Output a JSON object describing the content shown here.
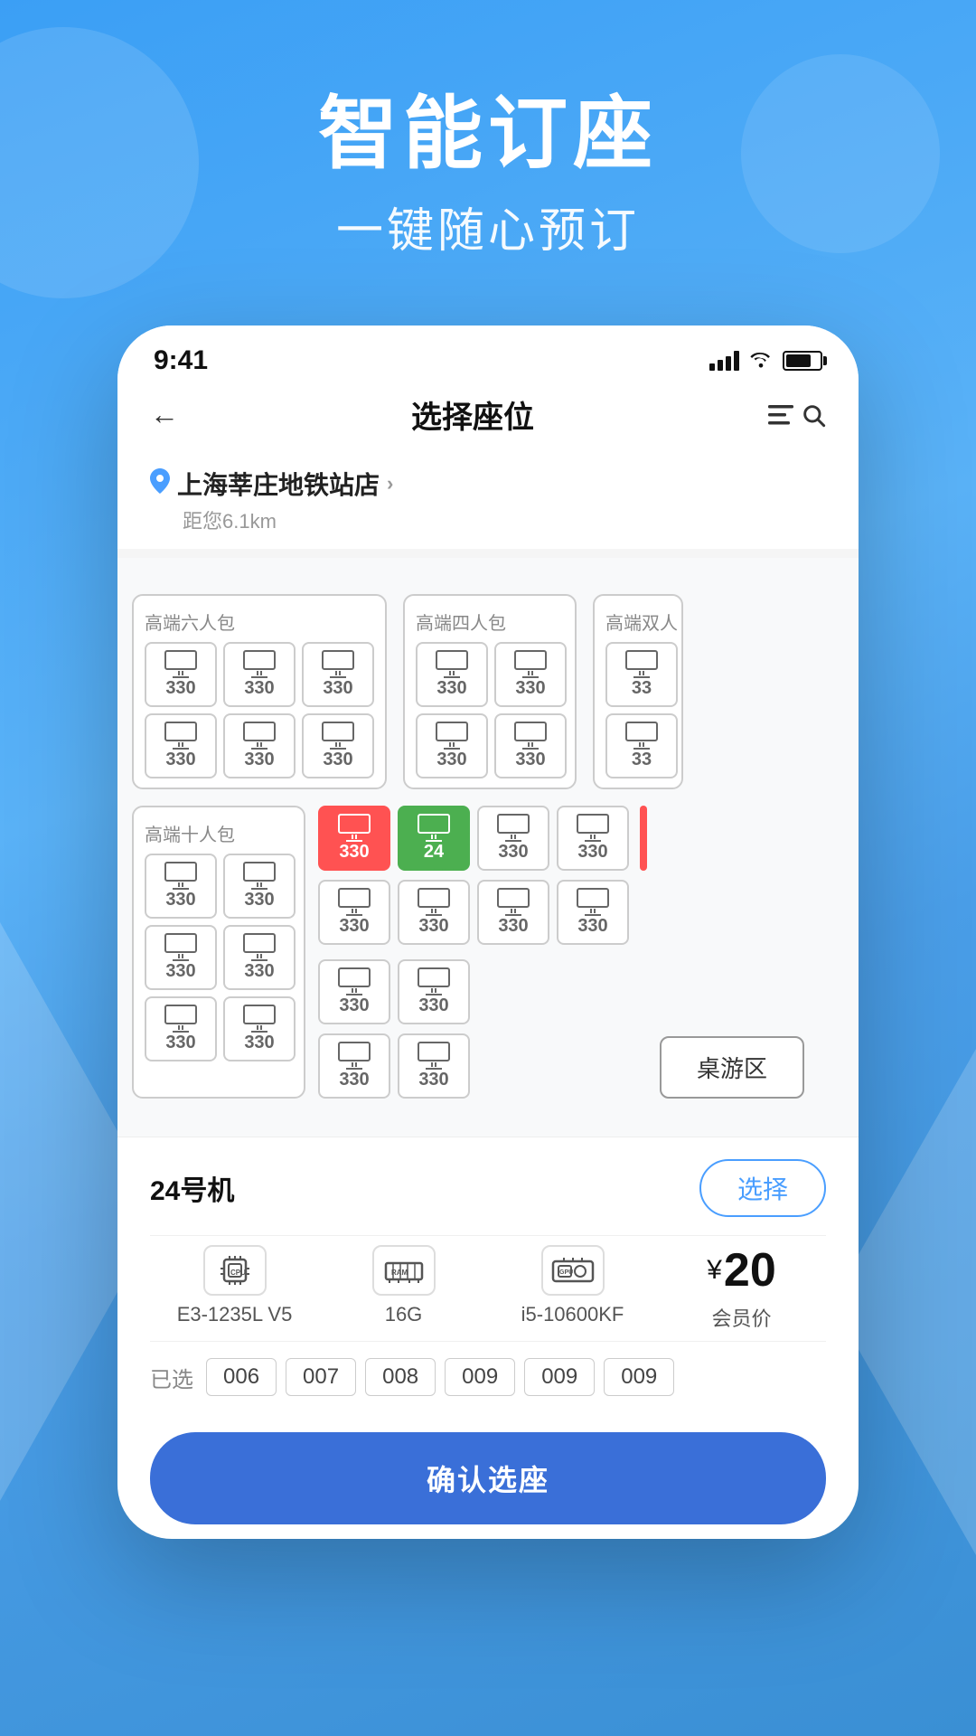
{
  "app": {
    "background_color": "#4a9ef5",
    "header_title": "智能订座",
    "header_subtitle": "一键随心预订"
  },
  "status_bar": {
    "time": "9:41",
    "signal_bars": 4,
    "wifi": true,
    "battery_pct": 75
  },
  "nav": {
    "back_icon": "←",
    "title": "选择座位",
    "right_icon": "≡🔍"
  },
  "location": {
    "pin_icon": "📍",
    "name": "上海莘庄地铁站店",
    "arrow": ">",
    "distance": "距您6.1km"
  },
  "rooms": [
    {
      "id": "r1",
      "label": "高端六人包",
      "seats": [
        "330",
        "330",
        "330",
        "330",
        "330",
        "330"
      ]
    },
    {
      "id": "r2",
      "label": "高端四人包",
      "seats": [
        "330",
        "330",
        "330",
        "330"
      ]
    },
    {
      "id": "r3",
      "label": "高端双人",
      "seats": [
        "33",
        "33"
      ]
    },
    {
      "id": "r4",
      "label": "高端十人包",
      "seats_left": [
        "330",
        "330",
        "330",
        "330",
        "330",
        "330"
      ],
      "seats_right_top": [
        "330(occ)",
        "24(sel)",
        "330",
        "330"
      ],
      "seats_right_bot": [
        "330",
        "330",
        "330",
        "330"
      ]
    }
  ],
  "board_game": {
    "label": "桌游区"
  },
  "machine_info": {
    "name": "24号机",
    "select_btn": "选择",
    "cpu_icon": "CPU",
    "cpu_value": "E3-1235L V5",
    "ram_icon": "RAM",
    "ram_value": "16G",
    "gpu_icon": "GPU",
    "gpu_value": "i5-10600KF",
    "price": "¥20",
    "price_unit": "",
    "price_label": "会员价"
  },
  "selected_seats": {
    "label": "已选",
    "seats": [
      "006",
      "007",
      "008",
      "009",
      "009",
      "009"
    ]
  },
  "confirm_btn": "确认选座"
}
